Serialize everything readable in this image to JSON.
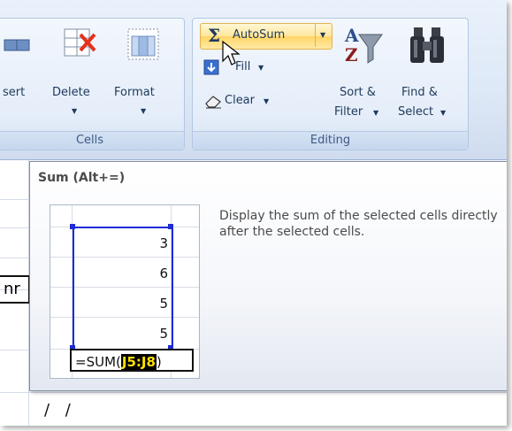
{
  "ribbon": {
    "cells_group": {
      "label": "Cells",
      "insert_label": "sert",
      "delete_label": "Delete",
      "format_label": "Format",
      "dropdown_arrow": "▼"
    },
    "editing_group": {
      "label": "Editing",
      "autosum_label": "AutoSum",
      "sigma": "Σ",
      "fill_label": "Fill",
      "clear_label": "Clear",
      "sort_label_1": "Sort &",
      "sort_label_2": "Filter",
      "find_label_1": "Find &",
      "find_label_2": "Select",
      "dropdown_arrow": "▼"
    }
  },
  "tooltip": {
    "title": "Sum (Alt+=)",
    "description": "Display the sum of the selected cells directly after the selected cells.",
    "preview": {
      "values": [
        "3",
        "6",
        "5",
        "5"
      ],
      "formula_prefix": "=SUM(",
      "formula_range": "J5:J8",
      "formula_suffix": ")"
    }
  },
  "sheet": {
    "partial_header": "nr",
    "bottom_marks": "/ /"
  },
  "colors": {
    "accent_highlight": "#ffe69b",
    "selection_border": "#1e2bd6",
    "ribbon_text": "#1e395b"
  }
}
